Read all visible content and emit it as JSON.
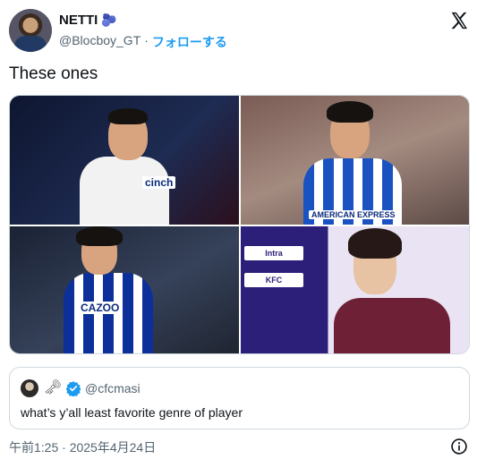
{
  "author": {
    "display_name": "NETTI",
    "name_emoji": "🫐",
    "handle": "@Blocboy_GT",
    "separator": "·",
    "follow_label": "フォローする"
  },
  "tweet": {
    "text": "These ones",
    "timestamp": "午前1:25 · 2025年4月24日"
  },
  "media": {
    "count": 4,
    "photos": [
      {
        "sponsor": "cinch"
      },
      {
        "sponsor": "AMERICAN EXPRESS"
      },
      {
        "sponsor": "CAZOO"
      },
      {
        "boards": [
          "Intra",
          "KFC"
        ]
      }
    ]
  },
  "quote": {
    "key_emoji": "🗝",
    "handle": "@cfcmasi",
    "text": "what’s y’all least favorite genre of player"
  },
  "colors": {
    "link": "#1d9bf0",
    "secondary_text": "#536471",
    "border": "#cfd9de"
  }
}
